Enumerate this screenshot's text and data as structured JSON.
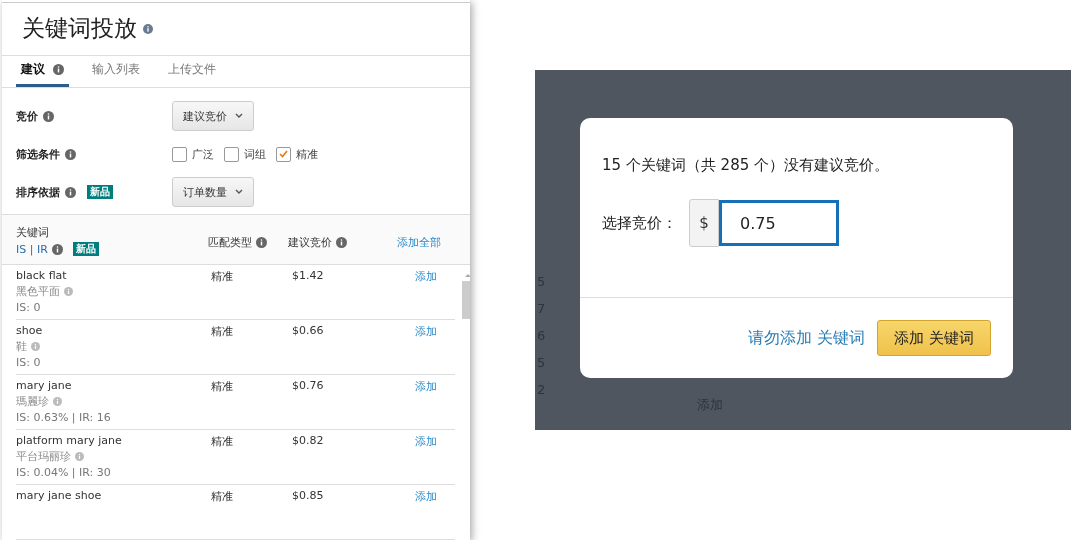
{
  "keyword_panel": {
    "title": "关键词投放",
    "tabs": [
      {
        "label": "建议",
        "selected": true,
        "info": true
      },
      {
        "label": "输入列表",
        "selected": false,
        "info": false
      },
      {
        "label": "上传文件",
        "selected": false,
        "info": false
      }
    ],
    "settings": [
      {
        "kind": "select",
        "label": "竞价",
        "value": "建议竞价"
      },
      {
        "kind": "checkboxes",
        "label": "筛选条件",
        "options": [
          {
            "label": "广泛",
            "checked": false
          },
          {
            "label": "词组",
            "checked": false
          },
          {
            "label": "精准",
            "checked": true
          }
        ]
      },
      {
        "kind": "select",
        "label": "排序依据",
        "badge": "新品",
        "value": "订单数量"
      }
    ],
    "table": {
      "columns": [
        {
          "label": "关键词",
          "sub": "IS | IR",
          "badge": "新品"
        },
        {
          "label": "匹配类型"
        },
        {
          "label": "建议竞价"
        }
      ],
      "add_all": "添加全部",
      "rows": [
        {
          "keyword": "black flat",
          "translation": "黑色平面",
          "metrics": "IS: 0",
          "match_type": "精准",
          "bid": "$1.42",
          "action": "添加"
        },
        {
          "keyword": "shoe",
          "translation": "鞋",
          "metrics": "IS: 0",
          "match_type": "精准",
          "bid": "$0.66",
          "action": "添加"
        },
        {
          "keyword": "mary jane",
          "translation": "瑪麗珍",
          "metrics": "IS: 0.63% | IR: 16",
          "match_type": "精准",
          "bid": "$0.76",
          "action": "添加"
        },
        {
          "keyword": "platform mary jane",
          "translation": "平台玛丽珍",
          "metrics": "IS: 0.04% | IR: 30",
          "match_type": "精准",
          "bid": "$0.82",
          "action": "添加"
        },
        {
          "keyword": "mary jane shoe",
          "match_type": "精准",
          "bid": "$0.85",
          "action": "添加"
        }
      ]
    }
  },
  "backdrop": {
    "column_1": [
      "5",
      "7",
      "6",
      "5",
      "2"
    ],
    "column_2": [
      "添加"
    ]
  },
  "dialog": {
    "message": "15 个关键词（共 285 个）没有建议竞价。",
    "bid_label": "选择竞价：",
    "currency": "$",
    "bid_value": "0.75",
    "cancel": "请勿添加 关键词",
    "confirm": "添加 关键词"
  }
}
